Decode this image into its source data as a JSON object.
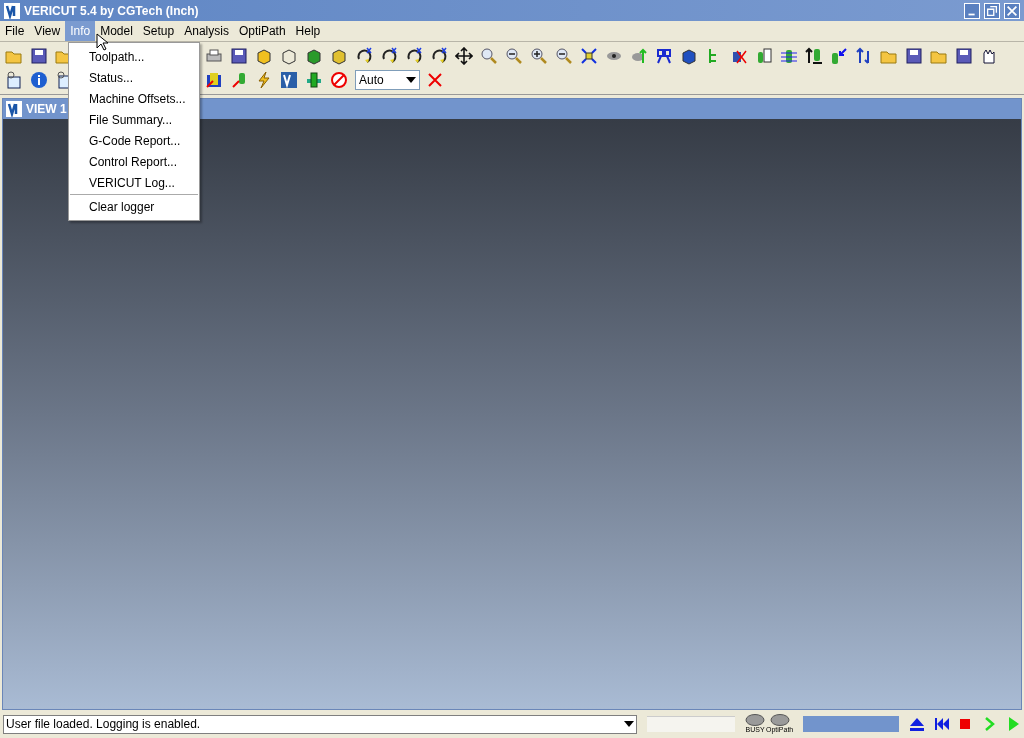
{
  "window": {
    "title": "VERICUT 5.4 by CGTech (Inch)"
  },
  "menu_bar": [
    {
      "label": "File",
      "selected": false
    },
    {
      "label": "View",
      "selected": false
    },
    {
      "label": "Info",
      "selected": true
    },
    {
      "label": "Model",
      "selected": false
    },
    {
      "label": "Setup",
      "selected": false
    },
    {
      "label": "Analysis",
      "selected": false
    },
    {
      "label": "OptiPath",
      "selected": false
    },
    {
      "label": "Help",
      "selected": false
    }
  ],
  "info_menu": [
    {
      "kind": "item",
      "label": "Toolpath..."
    },
    {
      "kind": "item",
      "label": "Status..."
    },
    {
      "kind": "item",
      "label": "Machine Offsets..."
    },
    {
      "kind": "item",
      "label": "File Summary..."
    },
    {
      "kind": "item",
      "label": "G-Code Report..."
    },
    {
      "kind": "item",
      "label": "Control Report..."
    },
    {
      "kind": "item",
      "label": "VERICUT Log..."
    },
    {
      "kind": "separator"
    },
    {
      "kind": "item",
      "label": "Clear logger"
    }
  ],
  "toolbar": {
    "animation_speed": {
      "value": "Auto"
    }
  },
  "view": {
    "title": "VIEW 1"
  },
  "status_bar": {
    "message": "User file loaded. Logging is enabled.",
    "lights": [
      "BUSY",
      "OptiPath"
    ],
    "progress": {
      "level": 1
    }
  }
}
